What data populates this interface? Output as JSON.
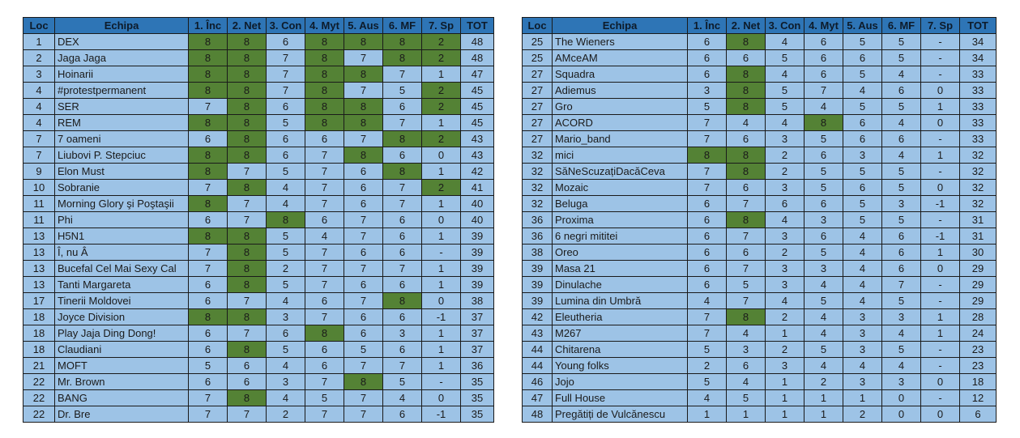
{
  "headers": [
    "Loc",
    "Echipa",
    "1. Înc",
    "2. Net",
    "3. Con",
    "4. Myt",
    "5. Aus",
    "6. MF",
    "7. Sp",
    "TOT"
  ],
  "colors": {
    "header": "#2e75b6",
    "cell": "#9dc3e6",
    "highlight": "#548235"
  },
  "left_table": [
    {
      "loc": "1",
      "team": "DEX",
      "scores": [
        "8",
        "8",
        "6",
        "8",
        "8",
        "8",
        "2"
      ],
      "hi": [
        1,
        1,
        0,
        1,
        1,
        1,
        1
      ],
      "tot": "48"
    },
    {
      "loc": "2",
      "team": "Jaga Jaga",
      "scores": [
        "8",
        "8",
        "7",
        "8",
        "7",
        "8",
        "2"
      ],
      "hi": [
        1,
        1,
        0,
        1,
        0,
        1,
        1
      ],
      "tot": "48"
    },
    {
      "loc": "3",
      "team": "Hoinarii",
      "scores": [
        "8",
        "8",
        "7",
        "8",
        "8",
        "7",
        "1"
      ],
      "hi": [
        1,
        1,
        0,
        1,
        1,
        0,
        0
      ],
      "tot": "47"
    },
    {
      "loc": "4",
      "team": "#protestpermanent",
      "scores": [
        "8",
        "8",
        "7",
        "8",
        "7",
        "5",
        "2"
      ],
      "hi": [
        1,
        1,
        0,
        1,
        0,
        0,
        1
      ],
      "tot": "45"
    },
    {
      "loc": "4",
      "team": "SER",
      "scores": [
        "7",
        "8",
        "6",
        "8",
        "8",
        "6",
        "2"
      ],
      "hi": [
        0,
        1,
        0,
        1,
        1,
        0,
        1
      ],
      "tot": "45"
    },
    {
      "loc": "4",
      "team": "REM",
      "scores": [
        "8",
        "8",
        "5",
        "8",
        "8",
        "7",
        "1"
      ],
      "hi": [
        1,
        1,
        0,
        1,
        1,
        0,
        0
      ],
      "tot": "45"
    },
    {
      "loc": "7",
      "team": "7 oameni",
      "scores": [
        "6",
        "8",
        "6",
        "6",
        "7",
        "8",
        "2"
      ],
      "hi": [
        0,
        1,
        0,
        0,
        0,
        1,
        1
      ],
      "tot": "43"
    },
    {
      "loc": "7",
      "team": "Liubovi P. Stepciuc",
      "scores": [
        "8",
        "8",
        "6",
        "7",
        "8",
        "6",
        "0"
      ],
      "hi": [
        1,
        1,
        0,
        0,
        1,
        0,
        0
      ],
      "tot": "43"
    },
    {
      "loc": "9",
      "team": "Elon Must",
      "scores": [
        "8",
        "7",
        "5",
        "7",
        "6",
        "8",
        "1"
      ],
      "hi": [
        1,
        0,
        0,
        0,
        0,
        1,
        0
      ],
      "tot": "42"
    },
    {
      "loc": "10",
      "team": "Sobranie",
      "scores": [
        "7",
        "8",
        "4",
        "7",
        "6",
        "7",
        "2"
      ],
      "hi": [
        0,
        1,
        0,
        0,
        0,
        0,
        1
      ],
      "tot": "41"
    },
    {
      "loc": "11",
      "team": "Morning Glory şi Poştaşii",
      "scores": [
        "8",
        "7",
        "4",
        "7",
        "6",
        "7",
        "1"
      ],
      "hi": [
        1,
        0,
        0,
        0,
        0,
        0,
        0
      ],
      "tot": "40"
    },
    {
      "loc": "11",
      "team": "Phi",
      "scores": [
        "6",
        "7",
        "8",
        "6",
        "7",
        "6",
        "0"
      ],
      "hi": [
        0,
        0,
        1,
        0,
        0,
        0,
        0
      ],
      "tot": "40"
    },
    {
      "loc": "13",
      "team": "H5N1",
      "scores": [
        "8",
        "8",
        "5",
        "4",
        "7",
        "6",
        "1"
      ],
      "hi": [
        1,
        1,
        0,
        0,
        0,
        0,
        0
      ],
      "tot": "39"
    },
    {
      "loc": "13",
      "team": "Î, nu Â",
      "scores": [
        "7",
        "8",
        "5",
        "7",
        "6",
        "6",
        "-"
      ],
      "hi": [
        0,
        1,
        0,
        0,
        0,
        0,
        0
      ],
      "tot": "39"
    },
    {
      "loc": "13",
      "team": "Bucefal Cel Mai Sexy Cal",
      "scores": [
        "7",
        "8",
        "2",
        "7",
        "7",
        "7",
        "1"
      ],
      "hi": [
        0,
        1,
        0,
        0,
        0,
        0,
        0
      ],
      "tot": "39"
    },
    {
      "loc": "13",
      "team": "Tanti Margareta",
      "scores": [
        "6",
        "8",
        "5",
        "7",
        "6",
        "6",
        "1"
      ],
      "hi": [
        0,
        1,
        0,
        0,
        0,
        0,
        0
      ],
      "tot": "39"
    },
    {
      "loc": "17",
      "team": "Tinerii Moldovei",
      "scores": [
        "6",
        "7",
        "4",
        "6",
        "7",
        "8",
        "0"
      ],
      "hi": [
        0,
        0,
        0,
        0,
        0,
        1,
        0
      ],
      "tot": "38"
    },
    {
      "loc": "18",
      "team": "Joyce Division",
      "scores": [
        "8",
        "8",
        "3",
        "7",
        "6",
        "6",
        "-1"
      ],
      "hi": [
        1,
        1,
        0,
        0,
        0,
        0,
        0
      ],
      "tot": "37"
    },
    {
      "loc": "18",
      "team": "Play Jaja Ding Dong!",
      "scores": [
        "6",
        "7",
        "6",
        "8",
        "6",
        "3",
        "1"
      ],
      "hi": [
        0,
        0,
        0,
        1,
        0,
        0,
        0
      ],
      "tot": "37"
    },
    {
      "loc": "18",
      "team": "Claudiani",
      "scores": [
        "6",
        "8",
        "5",
        "6",
        "5",
        "6",
        "1"
      ],
      "hi": [
        0,
        1,
        0,
        0,
        0,
        0,
        0
      ],
      "tot": "37"
    },
    {
      "loc": "21",
      "team": "MOFT",
      "scores": [
        "5",
        "6",
        "4",
        "6",
        "7",
        "7",
        "1"
      ],
      "hi": [
        0,
        0,
        0,
        0,
        0,
        0,
        0
      ],
      "tot": "36"
    },
    {
      "loc": "22",
      "team": "Mr. Brown",
      "scores": [
        "6",
        "6",
        "3",
        "7",
        "8",
        "5",
        "-"
      ],
      "hi": [
        0,
        0,
        0,
        0,
        1,
        0,
        0
      ],
      "tot": "35"
    },
    {
      "loc": "22",
      "team": "BANG",
      "scores": [
        "7",
        "8",
        "4",
        "5",
        "7",
        "4",
        "0"
      ],
      "hi": [
        0,
        1,
        0,
        0,
        0,
        0,
        0
      ],
      "tot": "35"
    },
    {
      "loc": "22",
      "team": "Dr. Bre",
      "scores": [
        "7",
        "7",
        "2",
        "7",
        "7",
        "6",
        "-1"
      ],
      "hi": [
        0,
        0,
        0,
        0,
        0,
        0,
        0
      ],
      "tot": "35"
    }
  ],
  "right_table": [
    {
      "loc": "25",
      "team": "The Wieners",
      "scores": [
        "6",
        "8",
        "4",
        "6",
        "5",
        "5",
        "-"
      ],
      "hi": [
        0,
        1,
        0,
        0,
        0,
        0,
        0
      ],
      "tot": "34"
    },
    {
      "loc": "25",
      "team": "AMceAM",
      "scores": [
        "6",
        "6",
        "5",
        "6",
        "6",
        "5",
        "-"
      ],
      "hi": [
        0,
        0,
        0,
        0,
        0,
        0,
        0
      ],
      "tot": "34"
    },
    {
      "loc": "27",
      "team": "Squadra",
      "scores": [
        "6",
        "8",
        "4",
        "6",
        "5",
        "4",
        "-"
      ],
      "hi": [
        0,
        1,
        0,
        0,
        0,
        0,
        0
      ],
      "tot": "33"
    },
    {
      "loc": "27",
      "team": "Adiemus",
      "scores": [
        "3",
        "8",
        "5",
        "7",
        "4",
        "6",
        "0"
      ],
      "hi": [
        0,
        1,
        0,
        0,
        0,
        0,
        0
      ],
      "tot": "33"
    },
    {
      "loc": "27",
      "team": "Gro",
      "scores": [
        "5",
        "8",
        "5",
        "4",
        "5",
        "5",
        "1"
      ],
      "hi": [
        0,
        1,
        0,
        0,
        0,
        0,
        0
      ],
      "tot": "33"
    },
    {
      "loc": "27",
      "team": "ACORD",
      "scores": [
        "7",
        "4",
        "4",
        "8",
        "6",
        "4",
        "0"
      ],
      "hi": [
        0,
        0,
        0,
        1,
        0,
        0,
        0
      ],
      "tot": "33"
    },
    {
      "loc": "27",
      "team": "Mario_band",
      "scores": [
        "7",
        "6",
        "3",
        "5",
        "6",
        "6",
        "-"
      ],
      "hi": [
        0,
        0,
        0,
        0,
        0,
        0,
        0
      ],
      "tot": "33"
    },
    {
      "loc": "32",
      "team": "mici",
      "scores": [
        "8",
        "8",
        "2",
        "6",
        "3",
        "4",
        "1"
      ],
      "hi": [
        1,
        1,
        0,
        0,
        0,
        0,
        0
      ],
      "tot": "32"
    },
    {
      "loc": "32",
      "team": "SăNeScuzațiDacăCeva",
      "scores": [
        "7",
        "8",
        "2",
        "5",
        "5",
        "5",
        "-"
      ],
      "hi": [
        0,
        1,
        0,
        0,
        0,
        0,
        0
      ],
      "tot": "32"
    },
    {
      "loc": "32",
      "team": "Mozaic",
      "scores": [
        "7",
        "6",
        "3",
        "5",
        "6",
        "5",
        "0"
      ],
      "hi": [
        0,
        0,
        0,
        0,
        0,
        0,
        0
      ],
      "tot": "32"
    },
    {
      "loc": "32",
      "team": "Beluga",
      "scores": [
        "6",
        "7",
        "6",
        "6",
        "5",
        "3",
        "-1"
      ],
      "hi": [
        0,
        0,
        0,
        0,
        0,
        0,
        0
      ],
      "tot": "32"
    },
    {
      "loc": "36",
      "team": "Proxima",
      "scores": [
        "6",
        "8",
        "4",
        "3",
        "5",
        "5",
        "-"
      ],
      "hi": [
        0,
        1,
        0,
        0,
        0,
        0,
        0
      ],
      "tot": "31"
    },
    {
      "loc": "36",
      "team": "6 negri mititei",
      "scores": [
        "6",
        "7",
        "3",
        "6",
        "4",
        "6",
        "-1"
      ],
      "hi": [
        0,
        0,
        0,
        0,
        0,
        0,
        0
      ],
      "tot": "31"
    },
    {
      "loc": "38",
      "team": "Oreo",
      "scores": [
        "6",
        "6",
        "2",
        "5",
        "4",
        "6",
        "1"
      ],
      "hi": [
        0,
        0,
        0,
        0,
        0,
        0,
        0
      ],
      "tot": "30"
    },
    {
      "loc": "39",
      "team": "Masa 21",
      "scores": [
        "6",
        "7",
        "3",
        "3",
        "4",
        "6",
        "0"
      ],
      "hi": [
        0,
        0,
        0,
        0,
        0,
        0,
        0
      ],
      "tot": "29"
    },
    {
      "loc": "39",
      "team": "Dinulache",
      "scores": [
        "6",
        "5",
        "3",
        "4",
        "4",
        "7",
        "-"
      ],
      "hi": [
        0,
        0,
        0,
        0,
        0,
        0,
        0
      ],
      "tot": "29"
    },
    {
      "loc": "39",
      "team": "Lumina din Umbră",
      "scores": [
        "4",
        "7",
        "4",
        "5",
        "4",
        "5",
        "-"
      ],
      "hi": [
        0,
        0,
        0,
        0,
        0,
        0,
        0
      ],
      "tot": "29"
    },
    {
      "loc": "42",
      "team": "Eleutheria",
      "scores": [
        "7",
        "8",
        "2",
        "4",
        "3",
        "3",
        "1"
      ],
      "hi": [
        0,
        1,
        0,
        0,
        0,
        0,
        0
      ],
      "tot": "28"
    },
    {
      "loc": "43",
      "team": "M267",
      "scores": [
        "7",
        "4",
        "1",
        "4",
        "3",
        "4",
        "1"
      ],
      "hi": [
        0,
        0,
        0,
        0,
        0,
        0,
        0
      ],
      "tot": "24"
    },
    {
      "loc": "44",
      "team": "Chitarena",
      "scores": [
        "5",
        "3",
        "2",
        "5",
        "3",
        "5",
        "-"
      ],
      "hi": [
        0,
        0,
        0,
        0,
        0,
        0,
        0
      ],
      "tot": "23"
    },
    {
      "loc": "44",
      "team": "Young folks",
      "scores": [
        "2",
        "6",
        "3",
        "4",
        "4",
        "4",
        "-"
      ],
      "hi": [
        0,
        0,
        0,
        0,
        0,
        0,
        0
      ],
      "tot": "23"
    },
    {
      "loc": "46",
      "team": "Jojo",
      "scores": [
        "5",
        "4",
        "1",
        "2",
        "3",
        "3",
        "0"
      ],
      "hi": [
        0,
        0,
        0,
        0,
        0,
        0,
        0
      ],
      "tot": "18"
    },
    {
      "loc": "47",
      "team": "Full House",
      "scores": [
        "4",
        "5",
        "1",
        "1",
        "1",
        "0",
        "-"
      ],
      "hi": [
        0,
        0,
        0,
        0,
        0,
        0,
        0
      ],
      "tot": "12"
    },
    {
      "loc": "48",
      "team": "Pregătiți de Vulcănescu",
      "scores": [
        "1",
        "1",
        "1",
        "1",
        "2",
        "0",
        "0"
      ],
      "hi": [
        0,
        0,
        0,
        0,
        0,
        0,
        0
      ],
      "tot": "6"
    }
  ]
}
